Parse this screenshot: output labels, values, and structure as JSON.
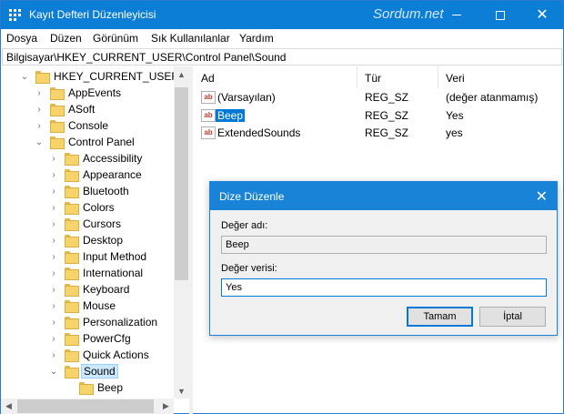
{
  "window": {
    "title": "Kayıt Defteri Düzenleyicisi",
    "watermark": "Sordum.net",
    "accent": "#0c7ed6"
  },
  "menu": [
    {
      "label": "Dosya"
    },
    {
      "label": "Düzen"
    },
    {
      "label": "Görünüm"
    },
    {
      "label": "Sık Kullanılanlar"
    },
    {
      "label": "Yardım"
    }
  ],
  "address": "Bilgisayar\\HKEY_CURRENT_USER\\Control Panel\\Sound",
  "tree": [
    {
      "label": "HKEY_CURRENT_USER",
      "expanded": true
    },
    {
      "label": "AppEvents"
    },
    {
      "label": "ASoft"
    },
    {
      "label": "Console"
    },
    {
      "label": "Control Panel",
      "expanded": true
    },
    {
      "label": "Accessibility"
    },
    {
      "label": "Appearance"
    },
    {
      "label": "Bluetooth"
    },
    {
      "label": "Colors"
    },
    {
      "label": "Cursors"
    },
    {
      "label": "Desktop"
    },
    {
      "label": "Input Method"
    },
    {
      "label": "International"
    },
    {
      "label": "Keyboard"
    },
    {
      "label": "Mouse"
    },
    {
      "label": "Personalization"
    },
    {
      "label": "PowerCfg"
    },
    {
      "label": "Quick Actions"
    },
    {
      "label": "Sound",
      "expanded": true,
      "selected": true
    },
    {
      "label": "Beep"
    }
  ],
  "columns": {
    "name": "Ad",
    "type": "Tür",
    "data": "Veri"
  },
  "values": [
    {
      "name": "(Varsayılan)",
      "type": "REG_SZ",
      "data": "(değer atanmamış)"
    },
    {
      "name": "Beep",
      "type": "REG_SZ",
      "data": "Yes",
      "selected": true
    },
    {
      "name": "ExtendedSounds",
      "type": "REG_SZ",
      "data": "yes"
    }
  ],
  "dialog": {
    "title": "Dize Düzenle",
    "name_label": "Değer adı:",
    "name_value": "Beep",
    "data_label": "Değer verisi:",
    "data_value": "Yes",
    "ok_label": "Tamam",
    "cancel_label": "İptal"
  }
}
